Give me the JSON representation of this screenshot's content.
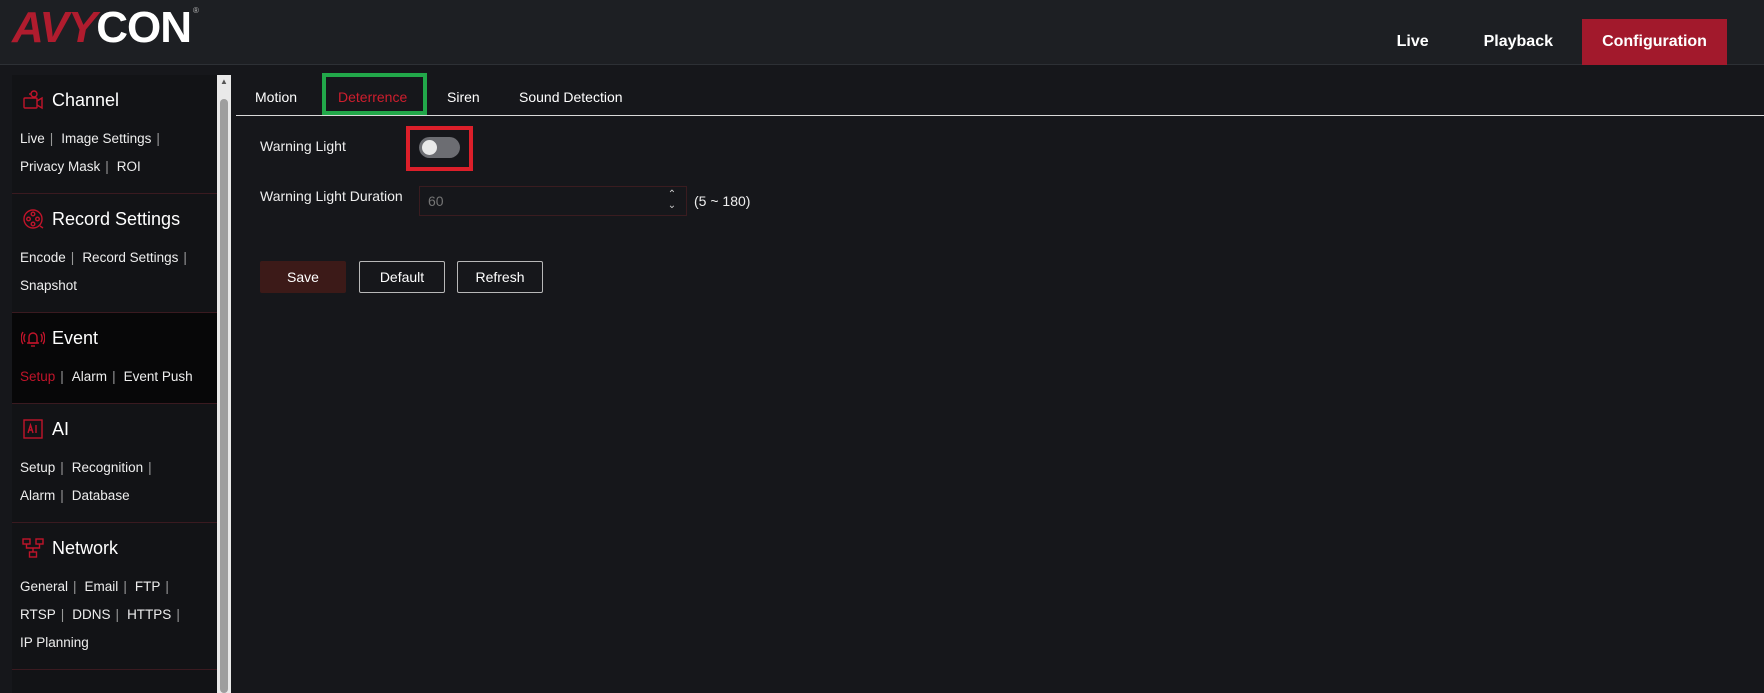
{
  "header": {
    "logo_red": "AVY",
    "logo_white": "CON",
    "logo_tm": "®",
    "nav": [
      {
        "label": "Live"
      },
      {
        "label": "Playback"
      },
      {
        "label": "Configuration"
      }
    ]
  },
  "sidebar": {
    "channel": {
      "title": "Channel",
      "links": [
        "Live",
        "Image Settings",
        "Privacy Mask",
        "ROI"
      ]
    },
    "record": {
      "title": "Record Settings",
      "links": [
        "Encode",
        "Record Settings",
        "Snapshot"
      ]
    },
    "event": {
      "title": "Event",
      "links": [
        "Setup",
        "Alarm",
        "Event Push"
      ]
    },
    "ai": {
      "title": "AI",
      "links": [
        "Setup",
        "Recognition",
        "Alarm",
        "Database"
      ]
    },
    "network": {
      "title": "Network",
      "links": [
        "General",
        "Email",
        "FTP",
        "RTSP",
        "DDNS",
        "HTTPS",
        "IP Planning"
      ]
    }
  },
  "tabs": [
    "Motion",
    "Deterrence",
    "Siren",
    "Sound Detection"
  ],
  "form": {
    "warning_light_label": "Warning Light",
    "warning_light_enabled": false,
    "duration_label": "Warning Light Duration",
    "duration_placeholder": "60",
    "duration_range": "(5 ~ 180)"
  },
  "buttons": {
    "save": "Save",
    "default": "Default",
    "refresh": "Refresh"
  },
  "colors": {
    "accent": "#a2192c",
    "active_text": "#cf1e2e",
    "highlight_green": "#22a84a",
    "highlight_red": "#dc1f2a"
  }
}
